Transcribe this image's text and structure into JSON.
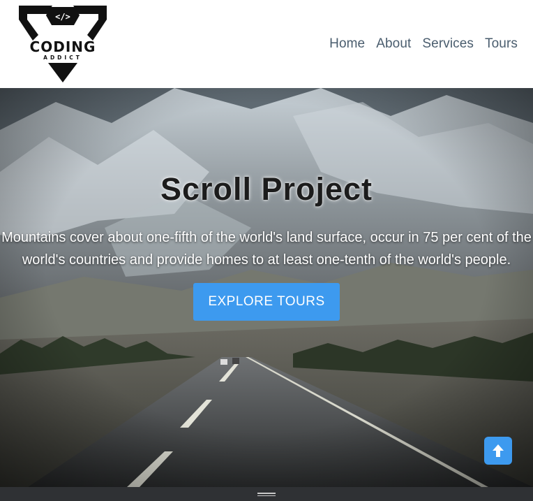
{
  "brand": {
    "logo_lines": [
      "CODING",
      "ADDICT"
    ],
    "logo_symbol": "</>"
  },
  "nav": {
    "items": [
      {
        "label": "Home"
      },
      {
        "label": "About"
      },
      {
        "label": "Services"
      },
      {
        "label": "Tours"
      }
    ]
  },
  "hero": {
    "title": "Scroll Project",
    "text": "Mountains cover about one-fifth of the world's land surface, occur in 75 per cent of the world's countries and provide homes to at least one-tenth of the world's people.",
    "button_label": "EXPLORE TOURS"
  },
  "scroll_top": {
    "icon": "arrow-up-icon"
  },
  "bottom_bar": {
    "icon": "drag-handle-icon"
  },
  "colors": {
    "accent": "#3d9aef",
    "nav_text": "#4a5d6e",
    "bottom_bar": "#2f3134"
  }
}
